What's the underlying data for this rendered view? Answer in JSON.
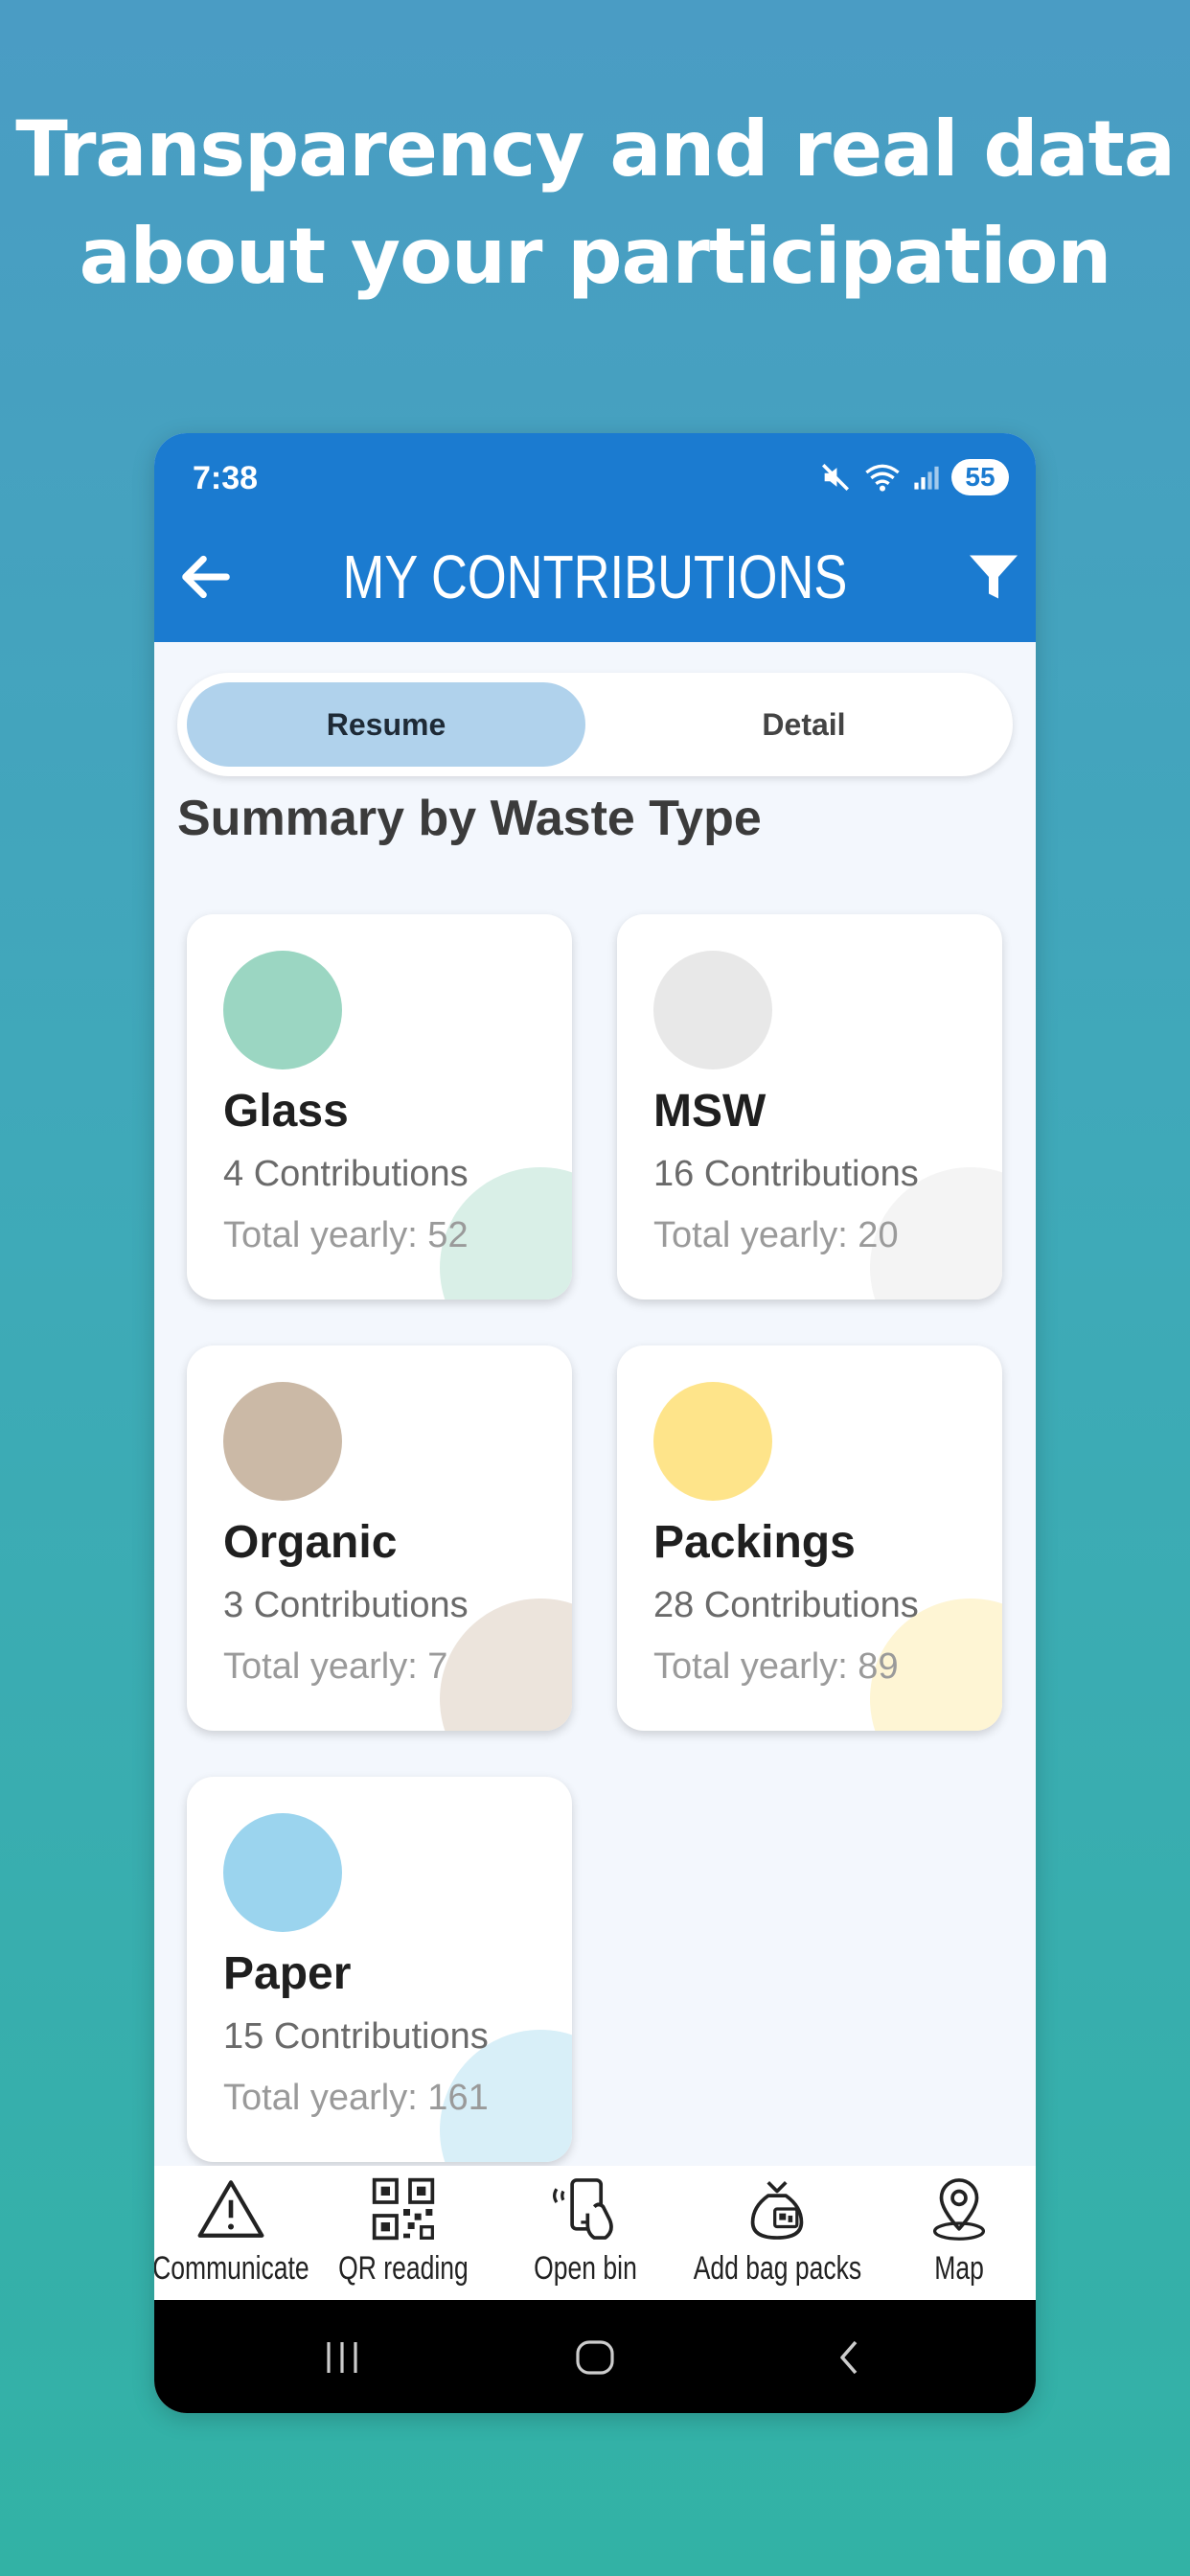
{
  "headline": {
    "line1": "Transparency and real data",
    "line2": "about your participation"
  },
  "status_bar": {
    "time": "7:38",
    "battery": "55"
  },
  "app_bar": {
    "title": "MY CONTRIBUTIONS"
  },
  "tabs": [
    {
      "label": "Resume",
      "active": true
    },
    {
      "label": "Detail",
      "active": false
    }
  ],
  "section_title": "Summary by Waste Type",
  "cards": [
    {
      "name": "Glass",
      "contributions": "4 Contributions",
      "total": "Total yearly: 52",
      "color": "#9bd6c2",
      "blob": "#d9efe7"
    },
    {
      "name": "MSW",
      "contributions": "16 Contributions",
      "total": "Total yearly: 20",
      "color": "#e8e8e8",
      "blob": "#f4f4f4"
    },
    {
      "name": "Organic",
      "contributions": "3 Contributions",
      "total": "Total yearly: 7",
      "color": "#cbb9a6",
      "blob": "#ece4dc"
    },
    {
      "name": "Packings",
      "contributions": "28 Contributions",
      "total": "Total yearly: 89",
      "color": "#fee48a",
      "blob": "#fef5d4"
    },
    {
      "name": "Paper",
      "contributions": "15 Contributions",
      "total": "Total yearly: 161",
      "color": "#9bd4ee",
      "blob": "#d8eff8"
    }
  ],
  "bottom_nav": [
    {
      "label": "Communicate",
      "icon": "warning-icon"
    },
    {
      "label": "QR reading",
      "icon": "qr-code-icon"
    },
    {
      "label": "Open bin",
      "icon": "phone-tap-icon"
    },
    {
      "label": "Add bag packs",
      "icon": "bag-icon"
    },
    {
      "label": "Map",
      "icon": "map-pin-icon"
    }
  ],
  "colors": {
    "app_bar": "#1b7bd0",
    "active_tab": "#b0d2ec",
    "screen_bg": "#f3f7fd"
  }
}
